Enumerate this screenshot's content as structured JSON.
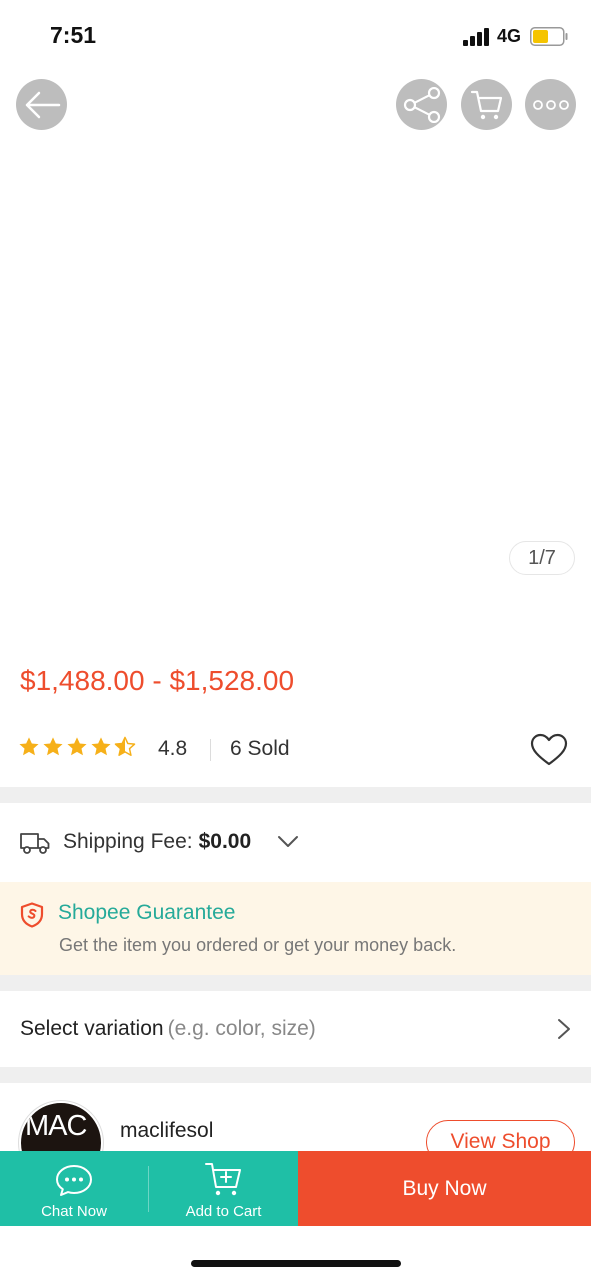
{
  "status_bar": {
    "time": "7:51",
    "network": "4G",
    "battery_color": "#f5c400"
  },
  "top_actions": {
    "back_icon": "arrow-left-icon",
    "share_icon": "share-icon",
    "cart_icon": "cart-icon",
    "more_icon": "more-horizontal-icon"
  },
  "gallery": {
    "counter": "1/7"
  },
  "product": {
    "price_range": "$1,488.00 - $1,528.00",
    "rating": "4.8",
    "rating_stars": 4.5,
    "sold": "6 Sold"
  },
  "shipping": {
    "label": "Shipping Fee:",
    "value": "$0.00"
  },
  "guarantee": {
    "title": "Shopee Guarantee",
    "subtitle": "Get the item you ordered or get your money back."
  },
  "variation": {
    "label": "Select variation",
    "hint": "(e.g. color, size)"
  },
  "shop": {
    "avatar_text": "MAC",
    "name": "maclifesol",
    "view_label": "View Shop"
  },
  "bottom_bar": {
    "chat_label": "Chat Now",
    "add_cart_label": "Add to Cart",
    "buy_label": "Buy Now"
  },
  "colors": {
    "accent": "#ee4d2d",
    "teal": "#1fbfa6",
    "guarantee_text": "#26aa99",
    "star": "#f6b019"
  }
}
